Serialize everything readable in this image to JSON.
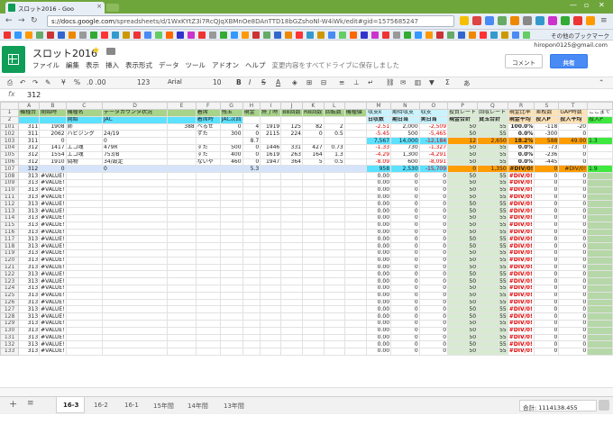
{
  "browser": {
    "tab_title": "スロット2016 - Goo",
    "tab_close": "×",
    "url_head": "s://docs.google.com",
    "url_rest": "/spreadsheets/d/1WxKYtZ3i7RcQJqXBMnOe8DAnTTD18bGZshoNl-W4iWk/edit#gid=1575685247",
    "bookmarks_other": "その他のブックマーク"
  },
  "docs": {
    "title": "スロット2016",
    "menu": [
      "ファイル",
      "編集",
      "表示",
      "挿入",
      "表示形式",
      "データ",
      "ツール",
      "アドオン",
      "ヘルプ"
    ],
    "save_message": "変更内容をすべてドライブに保存しました",
    "user_email": "hiropon0125@gmail.com",
    "comment_label": "コメント",
    "share_label": "共有"
  },
  "toolbar": {
    "currency": "¥",
    "percent": "%",
    "decimals": ".0 .00",
    "format123": "123",
    "font": "Arial",
    "fontsize": "10",
    "bold": "B",
    "italic": "I",
    "strike": "S",
    "textcolor": "A",
    "sum": "Σ",
    "input": "あ"
  },
  "formula": {
    "fx": "fx",
    "value": "312"
  },
  "grid": {
    "columns": [
      "",
      "A",
      "B",
      "C",
      "D",
      "E",
      "F",
      "G",
      "H",
      "I",
      "J",
      "K",
      "L",
      "M",
      "N",
      "O",
      "P",
      "Q",
      "R",
      "S",
      "T"
    ],
    "row1": [
      "1",
      "機種台",
      "開始時",
      "機種名",
      "データカウンタ状況",
      "",
      "着席",
      "残玉",
      "現金",
      "終了時",
      "BB回数",
      "RB回数",
      "回転数",
      "機種値",
      "収支k",
      "期待収支",
      "収支",
      "投資レート",
      "回収レート",
      "現金比率",
      "差枚数",
      "GAP時数",
      "ここまで"
    ],
    "row2": [
      "2",
      "",
      "",
      "開始",
      "JAC",
      "",
      "着席時",
      "JAC次回",
      "",
      "",
      "",
      "",
      "",
      "",
      "日収数",
      "期日当",
      "実日当",
      "現金合計",
      "貸玉合計",
      "現金平均",
      "投入P",
      "投入平均",
      "投入P"
    ],
    "rows": [
      [
        "101",
        "311",
        "1908",
        "姉",
        "",
        "388",
        "べるぜ",
        "0",
        "4",
        "1919",
        "125",
        "82",
        "2",
        "",
        "-2.51",
        "2,000",
        "-2,509",
        "50",
        "55",
        "100.0%",
        "-118",
        "-20",
        ""
      ],
      [
        "102",
        "311",
        "2062",
        "ハビジング",
        "24/19",
        "",
        "ずた",
        "300",
        "0",
        "2115",
        "224",
        "0",
        "0.5",
        "",
        "-5.45",
        "500",
        "-5,465",
        "50",
        "55",
        "0.0%",
        "-300",
        "0",
        ""
      ],
      [
        "103",
        "311",
        "0",
        "",
        "0",
        "",
        "",
        "",
        "8.7",
        "",
        "",
        "",
        "",
        "",
        "7,567",
        "14,000",
        "-12,184",
        "12",
        "2,650",
        "18.2%",
        "588",
        "49.00",
        "1.3"
      ],
      [
        "104",
        "312",
        "1417",
        "エコ魂",
        "479R",
        "",
        "ずた",
        "500",
        "0",
        "1446",
        "331",
        "427",
        "0.73",
        "",
        "-1.33",
        "730",
        "-1,327",
        "50",
        "55",
        "0.0%",
        "-73",
        "0",
        ""
      ],
      [
        "105",
        "312",
        "1554",
        "エコ魂",
        "753/B",
        "",
        "ずた",
        "400",
        "0",
        "1619",
        "263",
        "164",
        "1.3",
        "",
        "-4.29",
        "1,300",
        "-4,291",
        "50",
        "55",
        "0.0%",
        "-236",
        "0",
        ""
      ],
      [
        "106",
        "312",
        "1910",
        "偽物",
        "34/設定",
        "",
        "ないや",
        "460",
        "0",
        "1947",
        "364",
        "5",
        "0.5",
        "",
        "-8.09",
        "600",
        "-8,091",
        "50",
        "55",
        "0.0%",
        "-445",
        "0",
        ""
      ],
      [
        "107",
        "312",
        "0",
        "",
        "0",
        "",
        "",
        "",
        "5.3",
        "",
        "",
        "",
        "",
        "",
        "958",
        "2,530",
        "-15,709",
        "0",
        "1,350",
        "#DIV/0!",
        "0",
        "#DIV/0!",
        "1.9"
      ]
    ],
    "value_error": "#VALUE!",
    "div_error": "#DIV/0!",
    "empty_start": 108,
    "empty_end": 133,
    "empty_a": "313",
    "empty_m": "0.00",
    "empty_n": "0",
    "empty_o": "0",
    "empty_p": "50",
    "empty_q": "55",
    "empty_s": "0",
    "empty_t": "0"
  },
  "sheets": {
    "tabs": [
      "16-3",
      "16-2",
      "16-1",
      "15年間",
      "14年間",
      "13年間"
    ],
    "active": "16-3",
    "sum_label": "合計: 1114138.455"
  },
  "colors": {
    "accent_green": "#0f9d58",
    "share_blue": "#4a8af4",
    "header_green": "#a8d38a",
    "cyan": "#5ce1ff",
    "orange": "#ff9d00"
  }
}
